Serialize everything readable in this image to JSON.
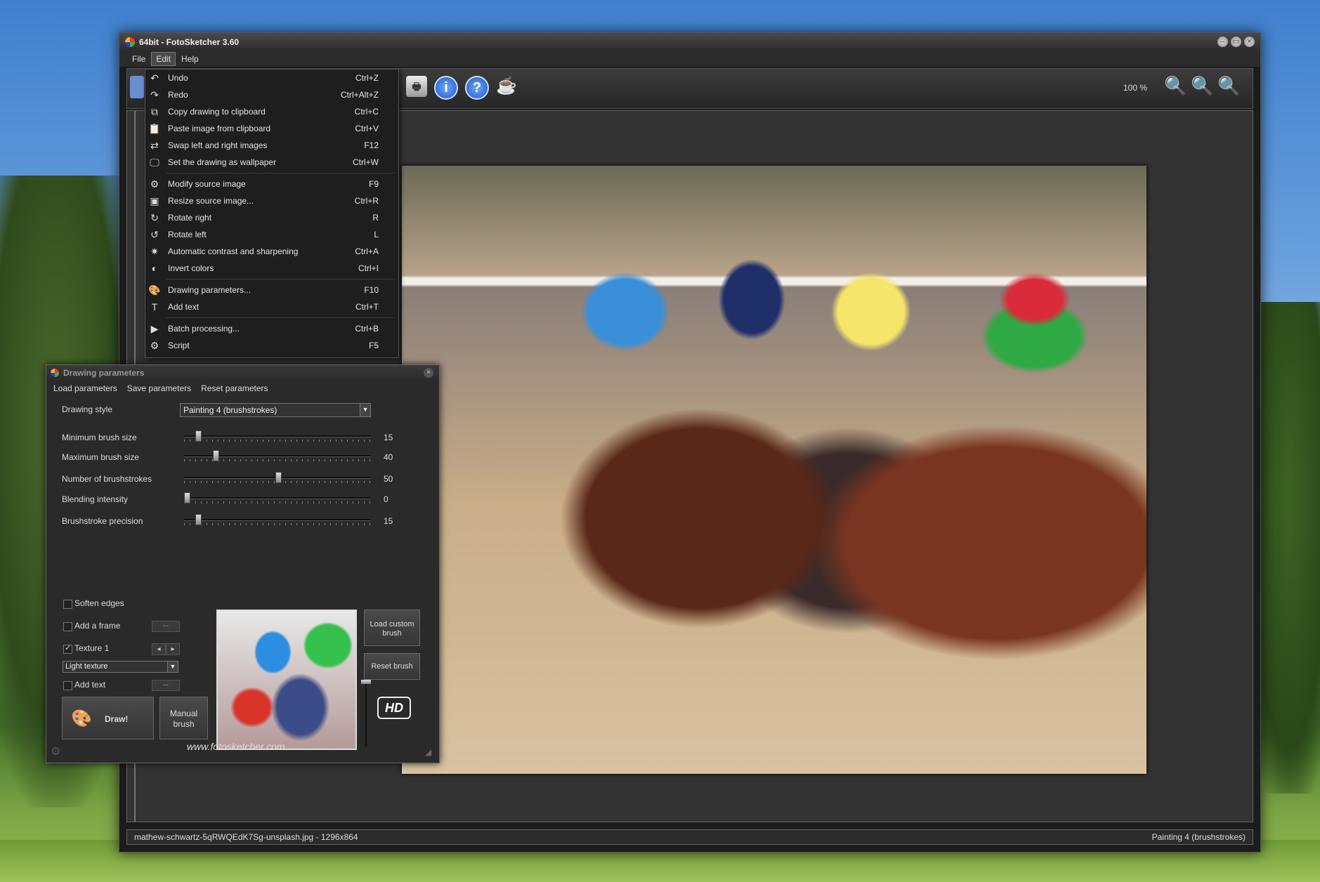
{
  "app": {
    "title": "64bit - FotoSketcher 3.60",
    "window_buttons": [
      "–",
      "▭",
      "×"
    ]
  },
  "menubar": {
    "items": [
      "File",
      "Edit",
      "Help"
    ]
  },
  "toolbar": {
    "zoom_level": "100 %",
    "icons": [
      "print-icon",
      "info-icon",
      "help-icon",
      "coffee-icon"
    ]
  },
  "edit_menu": [
    {
      "icon": "↶",
      "label": "Undo",
      "shortcut": "Ctrl+Z"
    },
    {
      "icon": "↷",
      "label": "Redo",
      "shortcut": "Ctrl+Alt+Z"
    },
    {
      "icon": "⧉",
      "label": "Copy drawing to clipboard",
      "shortcut": "Ctrl+C"
    },
    {
      "icon": "📋",
      "label": "Paste image from clipboard",
      "shortcut": "Ctrl+V"
    },
    {
      "icon": "⇄",
      "label": "Swap left and right images",
      "shortcut": "F12"
    },
    {
      "icon": "🖵",
      "label": "Set the drawing as wallpaper",
      "shortcut": "Ctrl+W",
      "sep_after": true
    },
    {
      "icon": "⚙",
      "label": "Modify source image",
      "shortcut": "F9"
    },
    {
      "icon": "▣",
      "label": "Resize source image...",
      "shortcut": "Ctrl+R"
    },
    {
      "icon": "↻",
      "label": "Rotate right",
      "shortcut": "R"
    },
    {
      "icon": "↺",
      "label": "Rotate left",
      "shortcut": "L"
    },
    {
      "icon": "✷",
      "label": "Automatic contrast and sharpening",
      "shortcut": "Ctrl+A"
    },
    {
      "icon": "◐",
      "label": "Invert colors",
      "shortcut": "Ctrl+I",
      "sep_after": true
    },
    {
      "icon": "🎨",
      "label": "Drawing parameters...",
      "shortcut": "F10"
    },
    {
      "icon": "T",
      "label": "Add text",
      "shortcut": "Ctrl+T",
      "sep_after": true
    },
    {
      "icon": "▶",
      "label": "Batch processing...",
      "shortcut": "Ctrl+B"
    },
    {
      "icon": "⚙",
      "label": "Script",
      "shortcut": "F5"
    }
  ],
  "drawing_params": {
    "title": "Drawing parameters",
    "menu": [
      "Load parameters",
      "Save parameters",
      "Reset parameters"
    ],
    "style_label": "Drawing style",
    "style_value": "Painting 4 (brushstrokes)",
    "sliders": [
      {
        "label": "Minimum brush size",
        "value": "15",
        "fraction": 0.06
      },
      {
        "label": "Maximum brush size",
        "value": "40",
        "fraction": 0.16
      },
      {
        "label": "Number of brushstrokes",
        "value": "50",
        "fraction": 0.5
      },
      {
        "label": "Blending intensity",
        "value": "0",
        "fraction": 0.0
      },
      {
        "label": "Brushstroke precision",
        "value": "15",
        "fraction": 0.06
      }
    ],
    "checkboxes": {
      "soften_edges": {
        "label": "Soften edges",
        "checked": false
      },
      "add_frame": {
        "label": "Add a frame",
        "checked": false
      },
      "texture": {
        "label": "Texture 1",
        "checked": true
      },
      "add_text": {
        "label": "Add text",
        "checked": false
      }
    },
    "texture_select": "Light texture",
    "ellipsis": "...",
    "draw_button": "Draw!",
    "manual_brush_button": "Manual brush",
    "load_custom_brush_button": "Load custom brush",
    "reset_brush_button": "Reset brush",
    "hd_badge": "HD",
    "website": "www.fotosketcher.com"
  },
  "status": {
    "left": "mathew-schwartz-5qRWQEdK7Sg-unsplash.jpg - 1296x864",
    "right": "Painting 4 (brushstrokes)"
  }
}
